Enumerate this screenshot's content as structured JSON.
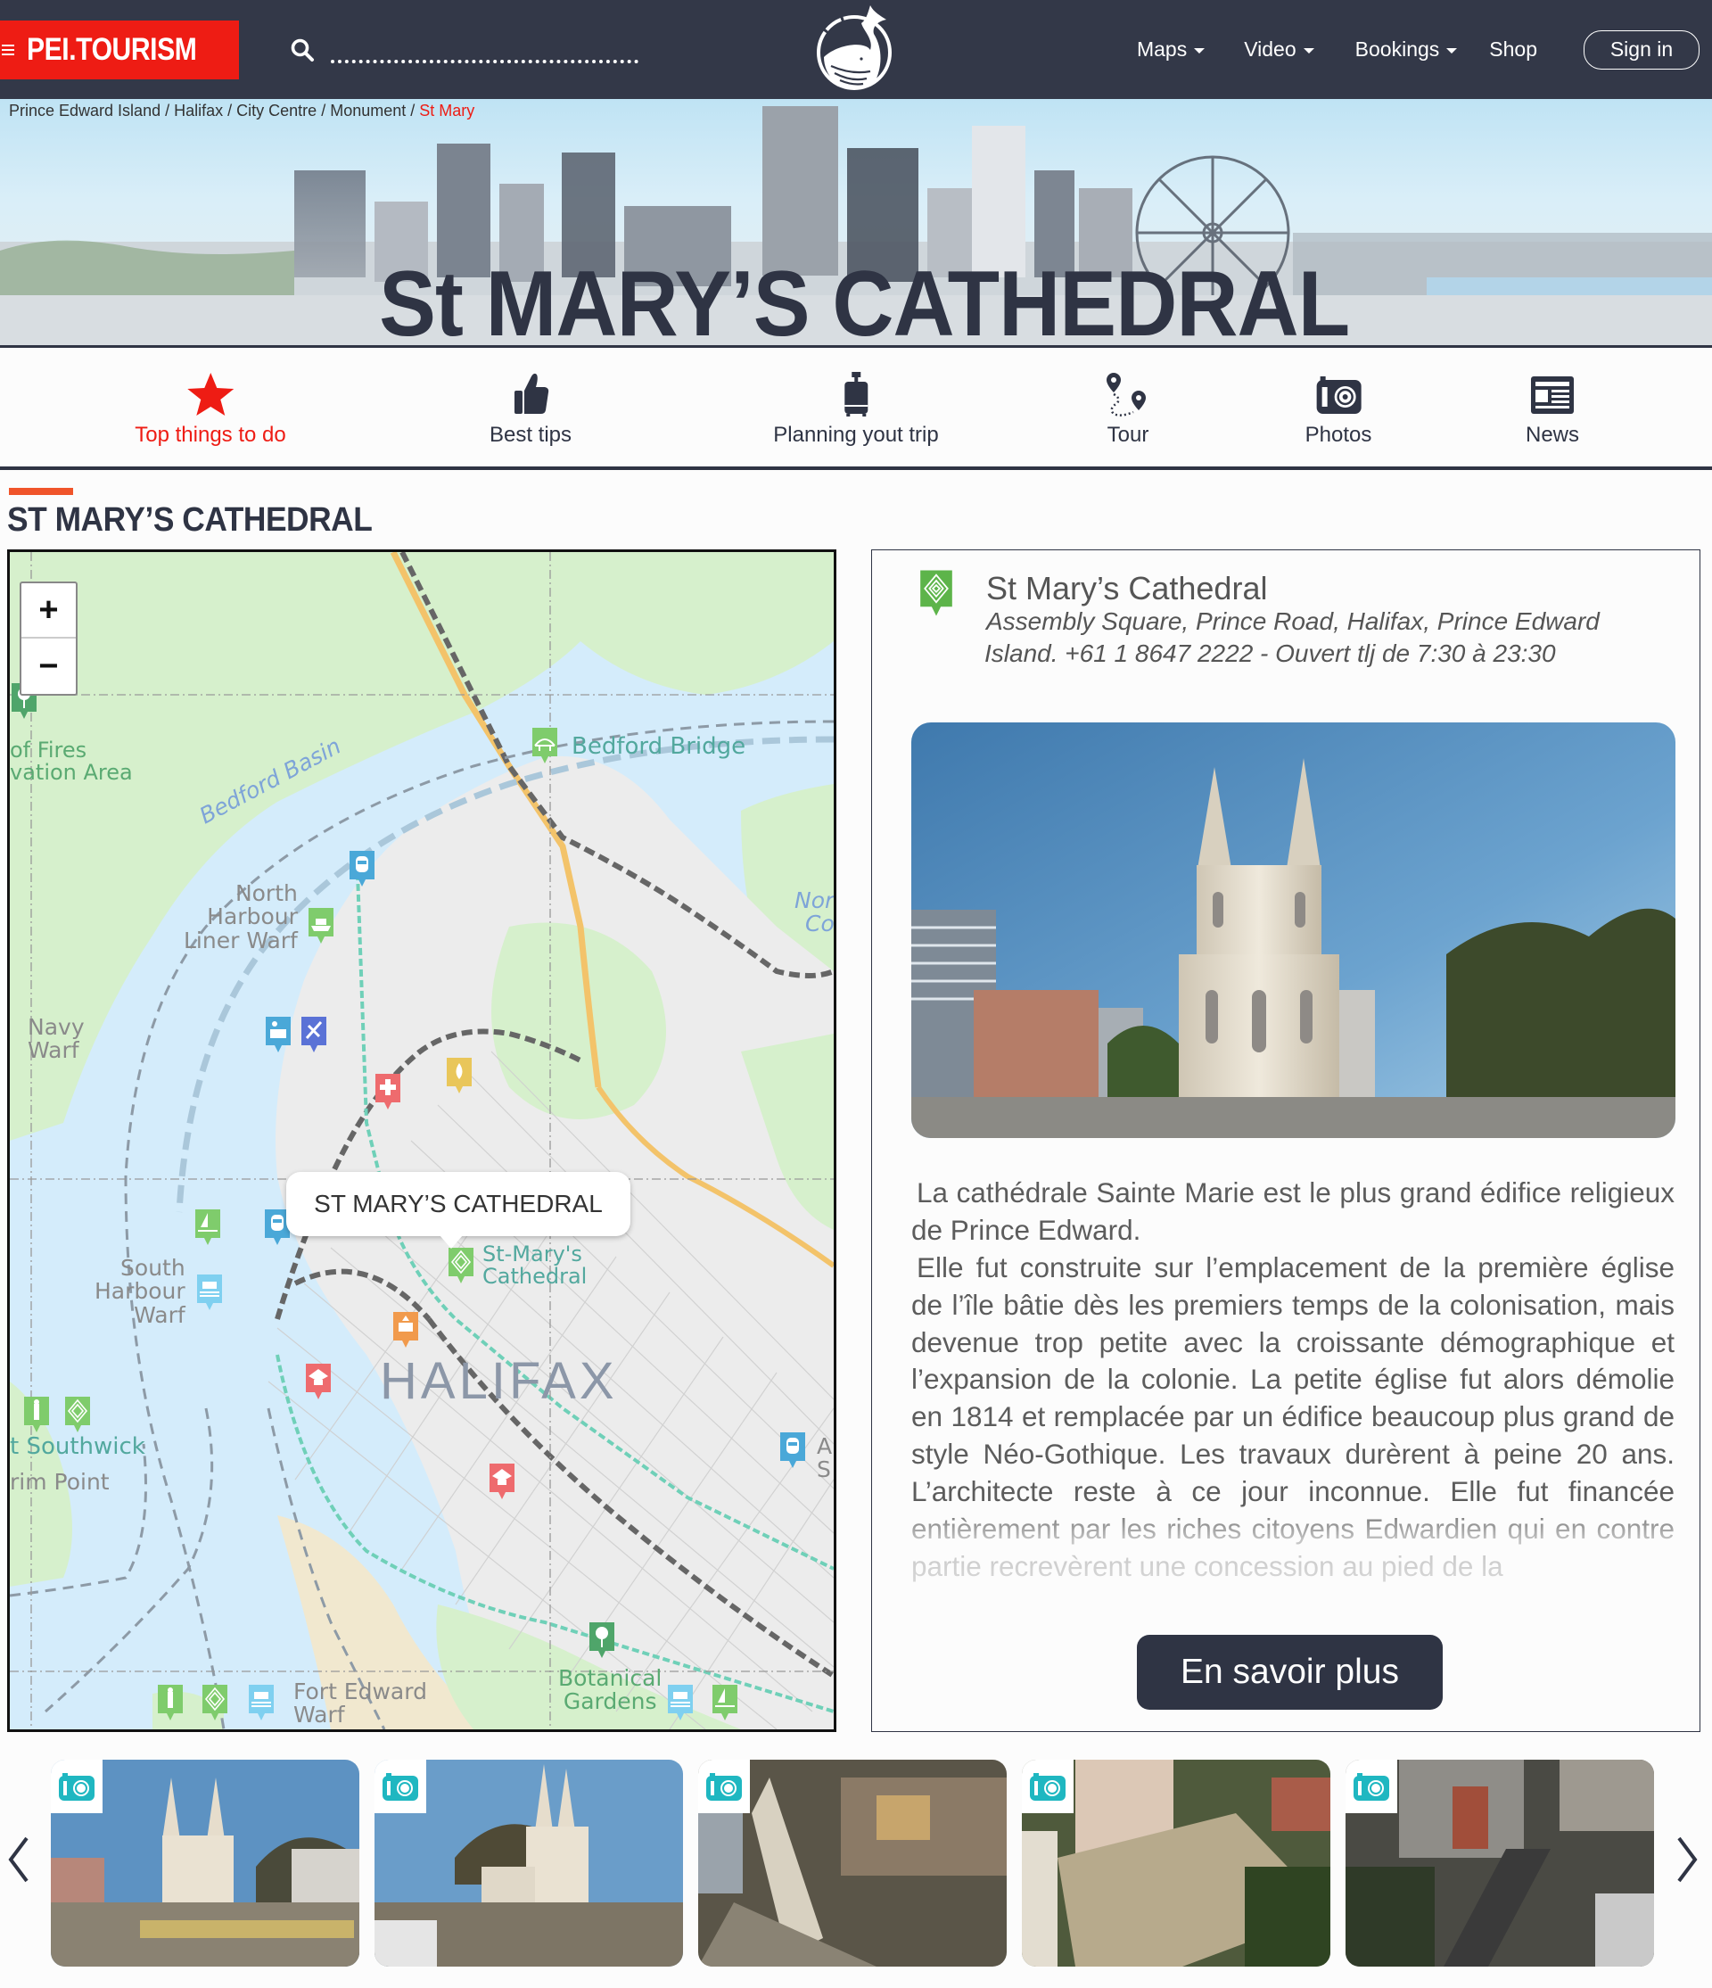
{
  "header": {
    "brand": "PEI.TOURISM",
    "search_placeholder": "",
    "search_icon": "search-icon",
    "logo_icon": "whale-logo-icon",
    "nav": [
      {
        "label": "Maps",
        "has_dropdown": true
      },
      {
        "label": "Video",
        "has_dropdown": true
      },
      {
        "label": "Bookings",
        "has_dropdown": true
      },
      {
        "label": "Shop",
        "has_dropdown": false
      }
    ],
    "sign_in": "Sign in"
  },
  "breadcrumb": {
    "items": [
      "Prince Edward Island",
      "Halifax",
      "City Centre",
      "Monument"
    ],
    "separator": " / ",
    "current": "St Mary"
  },
  "hero": {
    "title": "St MARY’S CATHEDRAL"
  },
  "icon_nav": [
    {
      "label": "Top things to do",
      "icon": "star-icon",
      "active": true
    },
    {
      "label": "Best tips",
      "icon": "thumbs-up-icon",
      "active": false
    },
    {
      "label": "Planning yout trip",
      "icon": "luggage-icon",
      "active": false
    },
    {
      "label": "Tour",
      "icon": "route-pins-icon",
      "active": false
    },
    {
      "label": "Photos",
      "icon": "camera-icon",
      "active": false
    },
    {
      "label": "News",
      "icon": "newspaper-icon",
      "active": false
    }
  ],
  "section": {
    "title": "ST MARY’S CATHEDRAL"
  },
  "map": {
    "zoom_in": "+",
    "zoom_out": "−",
    "popup": "ST MARY’S CATHEDRAL",
    "city_label": "HALIFAX",
    "labels": {
      "fires_area": [
        "of Fires",
        "vation Area"
      ],
      "bedford_bridge": "Bedford Bridge",
      "bedford_basin": "Bedford Basin",
      "north_harbour": [
        "North",
        "Harbour",
        "Liner Warf"
      ],
      "north_cove": [
        "Nor",
        "Co"
      ],
      "navy_warf": [
        "Navy",
        "Warf"
      ],
      "south_harbour": [
        "South",
        "Harbour",
        "Warf"
      ],
      "st_marys": [
        "St-Mary's",
        "Cathedral"
      ],
      "southwick": "t Southwick",
      "rim_point": "rim Point",
      "fort_edward": [
        "Fort Edward",
        "Warf"
      ],
      "botanical": [
        "Botanical",
        "Gardens"
      ],
      "station_right": [
        "A",
        "S"
      ]
    },
    "colors": {
      "water": "#d4ecfb",
      "park": "#d6f0cc",
      "urban": "#ececec",
      "monument_pin": "#6bbf59",
      "transit_pin": "#4aa8d8",
      "health_pin": "#ee6b6e",
      "education_pin": "#ee6b6e",
      "government_pin": "#f19a4c",
      "fuel_pin": "#e9c65a",
      "airport_pin": "#5a72d6"
    }
  },
  "info": {
    "name": "St Mary’s Cathedral",
    "address": "Assembly Square, Prince Road, Halifax, Prince Edward Island. +61 1 8647 2222 - Ouvert tlj de 7:30 à 23:30",
    "paragraphs": [
      "La cathédrale Sainte Marie est le plus grand édifice religieux de Prince Edward.",
      "Elle fut construite sur l’emplacement de la première église de l’île bâtie dès les premiers temps de la colonisation, mais devenue trop petite avec la croissante démographique et l’expansion de la colonie. La petite église fut alors démolie en 1814 et remplacée par un édifice beaucoup plus grand de style Néo-Gothique. Les travaux durèrent à peine 20 ans. L’architecte reste à ce jour inconnue. Elle fut financée entièrement par les riches citoyens Edwardien qui en contre partie recrevèrent une concession au pied de la"
    ],
    "more_button": "En savoir plus"
  },
  "gallery": {
    "prev_icon": "chevron-left-icon",
    "next_icon": "chevron-right-icon",
    "thumb_count": 5,
    "badge_icon": "camera-icon",
    "badge_color": "#1fb7c1"
  },
  "colors": {
    "navy": "#333848",
    "brand_red": "#ee1c14",
    "accent_orange": "#f0542a",
    "text_dark": "#2f3444"
  }
}
